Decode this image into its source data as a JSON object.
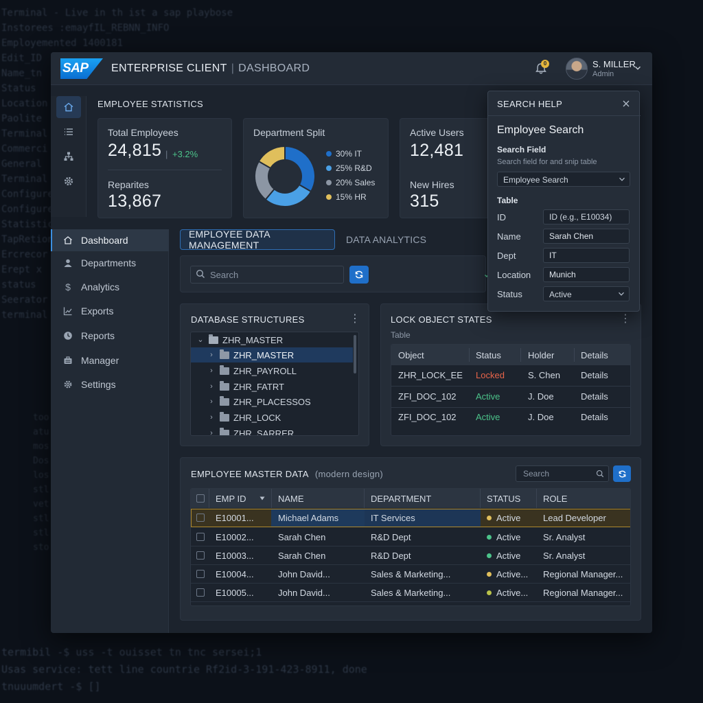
{
  "terminal": {
    "top_lines": "Terminal - Live in th ist a sap playbose\nInstorees :emayfIL_REBNN_INFO\nEmployemented 1400181\nEdit_ID\nName_tn\nStatus\nLocation\nPaolite\nTerminal\nCommerci\nGeneral\nTerminal\nConfigure\nConfigure\nStatistic\nTapRetion\nErcrecor\nErept x\nstatus\nSeerator\nterminal",
    "mid_lines": "too\natu\nmos\nDos\nlos\nstl\nvet\nstl\nstl\nsto",
    "bottom_lines": "termibil -$ uss -t ouisset tn tnc sersei;1\nUsas service: tett line countrie Rf2id-3-191-423-8911, done\ntnuuumdert -$ []"
  },
  "header": {
    "logo_text": "SAP",
    "app_title": "ENTERPRISE CLIENT",
    "separator": "|",
    "app_subtitle": "DASHBOARD",
    "notification_count": "0",
    "user_name": "S. MILLER",
    "user_role": "Admin"
  },
  "stats": {
    "section_title": "EMPLOYEE STATISTICS",
    "total_label": "Total Employees",
    "total_value": "24,815",
    "total_delta_sep": "|",
    "total_delta": "+3.2%",
    "reparites_label": "Reparites",
    "reparites_value": "13,867",
    "dept_label": "Department Split",
    "dept_split": [
      {
        "label": "30% IT",
        "value": 30,
        "color": "#1f6fc9"
      },
      {
        "label": "25% R&D",
        "value": 25,
        "color": "#4aa0e6"
      },
      {
        "label": "20% Sales",
        "value": 20,
        "color": "#8c96a4"
      },
      {
        "label": "15% HR",
        "value": 15,
        "color": "#e0bf5c"
      }
    ],
    "active_label": "Active Users",
    "active_value": "12,481",
    "hires_label": "New Hires",
    "hires_value": "315"
  },
  "nav": {
    "items": [
      {
        "label": "Dashboard",
        "icon": "home-icon"
      },
      {
        "label": "Departments",
        "icon": "person-icon"
      },
      {
        "label": "Analytics",
        "icon": "dollar-icon"
      },
      {
        "label": "Exports",
        "icon": "chart-icon"
      },
      {
        "label": "Reports",
        "icon": "clock-icon"
      },
      {
        "label": "Manager",
        "icon": "briefcase-icon"
      },
      {
        "label": "Settings",
        "icon": "gear-icon"
      }
    ]
  },
  "tabs": {
    "active": "EMPLOYEE DATA MANAGEMENT",
    "inactive": "DATA ANALYTICS"
  },
  "toolbar": {
    "search_placeholder": "Search"
  },
  "db": {
    "title": "DATABASE STRUCTURES",
    "root": "ZHR_MASTER",
    "children": [
      "ZHR_MASTER",
      "ZHR_PAYROLL",
      "ZHR_FATRT",
      "ZHR_PLACESSOS",
      "ZHR_LOCK",
      "ZHR_SARRER"
    ]
  },
  "lock": {
    "title": "LOCK OBJECT STATES",
    "subtitle": "Table",
    "columns": [
      "Object",
      "Status",
      "Holder",
      "Details"
    ],
    "rows": [
      {
        "object": "ZHR_LOCK_EE",
        "status": "Locked",
        "holder": "S. Chen",
        "details": "Details"
      },
      {
        "object": "ZFI_DOC_102",
        "status": "Active",
        "holder": "J. Doe",
        "details": "Details"
      },
      {
        "object": "ZFI_DOC_102",
        "status": "Active",
        "holder": "J. Doe",
        "details": "Details"
      }
    ]
  },
  "master": {
    "title": "EMPLOYEE MASTER DATA",
    "subtitle": "(modern design)",
    "search_placeholder": "Search",
    "columns": [
      "EMP ID",
      "NAME",
      "DEPARTMENT",
      "STATUS",
      "ROLE"
    ],
    "rows": [
      {
        "id": "E10001...",
        "name": "Michael Adams",
        "dept": "IT Services",
        "status": "Active",
        "status_color": "#e0bf5c",
        "role": "Lead Developer"
      },
      {
        "id": "E10002...",
        "name": "Sarah Chen",
        "dept": "R&D Dept",
        "status": "Active",
        "status_color": "#4cc38a",
        "role": "Sr. Analyst"
      },
      {
        "id": "E10003...",
        "name": "Sarah Chen",
        "dept": "R&D Dept",
        "status": "Active",
        "status_color": "#4cc38a",
        "role": "Sr. Analyst"
      },
      {
        "id": "E10004...",
        "name": "John David...",
        "dept": "Sales & Marketing...",
        "status": "Active...",
        "status_color": "#e0bf5c",
        "role": "Regional Manager..."
      },
      {
        "id": "E10005...",
        "name": "John David...",
        "dept": "Sales & Marketing...",
        "status": "Active...",
        "status_color": "#b9c24a",
        "role": "Regional Manager..."
      }
    ]
  },
  "search_help": {
    "title": "SEARCH HELP",
    "heading": "Employee Search",
    "field_label": "Search Field",
    "field_hint": "Search field for and snip table",
    "field_value": "Employee Search",
    "table_label": "Table",
    "fields": [
      {
        "label": "ID",
        "value": "",
        "placeholder": "ID (e.g., E10034)"
      },
      {
        "label": "Name",
        "value": "Sarah Chen"
      },
      {
        "label": "Dept",
        "value": "IT"
      },
      {
        "label": "Location",
        "value": "Munich"
      }
    ],
    "status_label": "Status",
    "status_value": "Active"
  },
  "colors": {
    "accent": "#1f6fc9",
    "locked": "#e8644a",
    "active": "#4cc38a"
  }
}
